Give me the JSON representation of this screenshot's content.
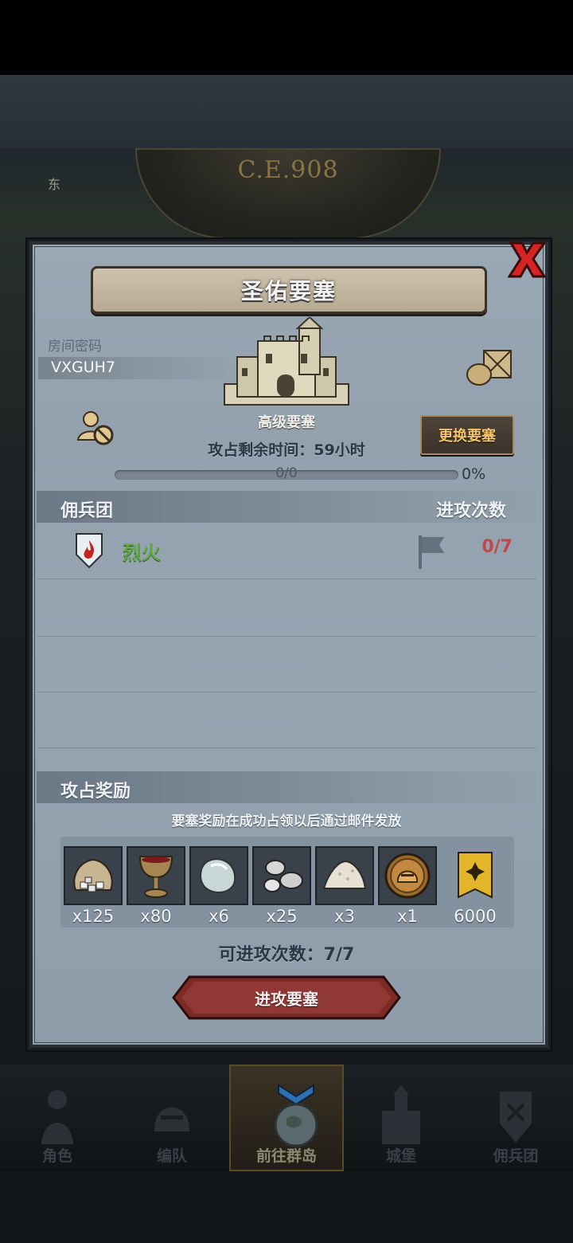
{
  "background": {
    "era_label": "C.E.908",
    "map_label": "东"
  },
  "dialog": {
    "title": "圣佑要塞",
    "room_label": "房间密码",
    "room_code": "VXGUH7",
    "fortress_level": "高级要塞",
    "change_button": "更换要塞",
    "time_remaining": "攻占剩余时间：59小时",
    "progress_text": "0/0",
    "progress_fraction": 0,
    "progress_percent": "0%",
    "mercenary_header": "佣兵团",
    "attack_count_header": "进攻次数",
    "mercenaries": [
      {
        "name": "烈火",
        "attacks": "0/7"
      }
    ],
    "reward_header": "攻占奖励",
    "reward_note": "要塞奖励在成功占领以后通过邮件发放",
    "rewards": [
      {
        "icon": "silver-ore-sack-icon",
        "qty": "x125"
      },
      {
        "icon": "goblet-icon",
        "qty": "x80"
      },
      {
        "icon": "crystal-stone-icon",
        "qty": "x6"
      },
      {
        "icon": "silver-nuggets-icon",
        "qty": "x25"
      },
      {
        "icon": "salt-pile-icon",
        "qty": "x3"
      },
      {
        "icon": "knight-helmet-coin-icon",
        "qty": "x1"
      },
      {
        "icon": "guild-banner-icon",
        "qty": "6000"
      }
    ],
    "attacks_left": "可进攻次数：7/7",
    "attack_button": "进攻要塞"
  },
  "bottom_nav": [
    {
      "label": "角色",
      "icon": "knight-icon",
      "active": false
    },
    {
      "label": "编队",
      "icon": "helmet-icon",
      "active": false
    },
    {
      "label": "前往群岛",
      "icon": "globe-icon",
      "active": true
    },
    {
      "label": "城堡",
      "icon": "castle-icon",
      "active": false
    },
    {
      "label": "佣兵团",
      "icon": "mercenary-icon",
      "active": false
    }
  ],
  "colors": {
    "panel_bg": "#97a5b1",
    "close_red": "#d62424",
    "merc_name_green": "#5fa843",
    "attack_count_red": "#c2474b",
    "change_button_text": "#f5c56b",
    "attack_button_red": "#7b2a26"
  }
}
